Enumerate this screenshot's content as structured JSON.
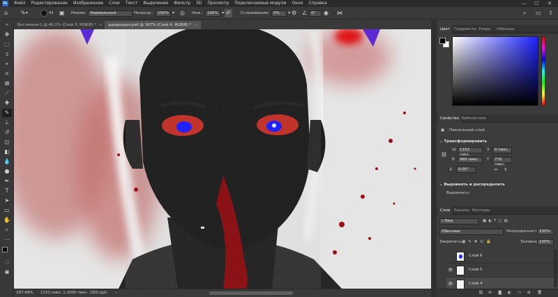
{
  "menu": {
    "app_logo": "Ps",
    "items": [
      "Файл",
      "Редактирование",
      "Изображение",
      "Слои",
      "Текст",
      "Выделение",
      "Фильтр",
      "3D",
      "Просмотр",
      "Подключаемые модули",
      "Окно",
      "Справка"
    ],
    "window_controls": [
      "—",
      "☐",
      "✕"
    ]
  },
  "options": {
    "brush_size": "43",
    "mode_label": "Режим:",
    "mode_value": "Нормальный",
    "opacity_label": "Непрозр.:",
    "opacity_value": "100%",
    "flow_label": "Наж.:",
    "flow_value": "100%",
    "smoothing_label": "Сглаживание:",
    "smoothing_value": "0%",
    "angle_value": "0°"
  },
  "tabs": [
    {
      "label": "Без имени-1 @ 40,1% (Слой 3, RGB/8) *",
      "close": "×"
    },
    {
      "label": "ддадьадал.psd @ 167% (Слой 4, RGB/8) *",
      "close": "×"
    }
  ],
  "status": {
    "zoom": "167,49%",
    "doc_size": "1152 пикс. x 2000 пикс. (300 ppi)",
    "arrow": "›"
  },
  "color_panel": {
    "tabs": [
      "Цвет",
      "Градиенты",
      "Узоры",
      "Образцы"
    ],
    "hue_color": "#1e23ff"
  },
  "properties": {
    "tabs": [
      "Свойства",
      "Библиотеки"
    ],
    "layer_type": "Пиксельный слой",
    "transform_header": "Трансформировать",
    "w_label": "Ш",
    "w_value": "1152 пикс.",
    "x_label": "X",
    "x_value": "0 пикс.",
    "h_label": "В",
    "h_value": "969 пикс.",
    "y_label": "Y",
    "y_value": "776 пикс.",
    "angle_value": "0,00°",
    "align_header": "Выровнять и распределить",
    "align_label": "Выровнять:"
  },
  "layers": {
    "tabs": [
      "Слои",
      "Каналы",
      "Контуры"
    ],
    "kind_value": "Вид",
    "blend_value": "Обычные",
    "opacity_label": "Непрозрачность:",
    "opacity_value": "100%",
    "lock_label": "Закрепить:",
    "fill_label": "Заливка:",
    "fill_value": "100%",
    "items": [
      {
        "name": "Слой 6",
        "visible": false
      },
      {
        "name": "Слой 5",
        "visible": true
      },
      {
        "name": "Слой 4",
        "visible": true
      }
    ],
    "footer_icons": [
      "link-icon",
      "fx-icon",
      "mask-icon",
      "adjustment-icon",
      "group-icon",
      "new-layer-icon",
      "trash-icon"
    ]
  },
  "colors": {
    "foreground": "#000000",
    "background": "#ffffff",
    "eye_iris": "#c0342c",
    "eye_pupil": "#1e22ff",
    "blood": "#9e1014",
    "accent_purple": "#5c2bd6"
  }
}
